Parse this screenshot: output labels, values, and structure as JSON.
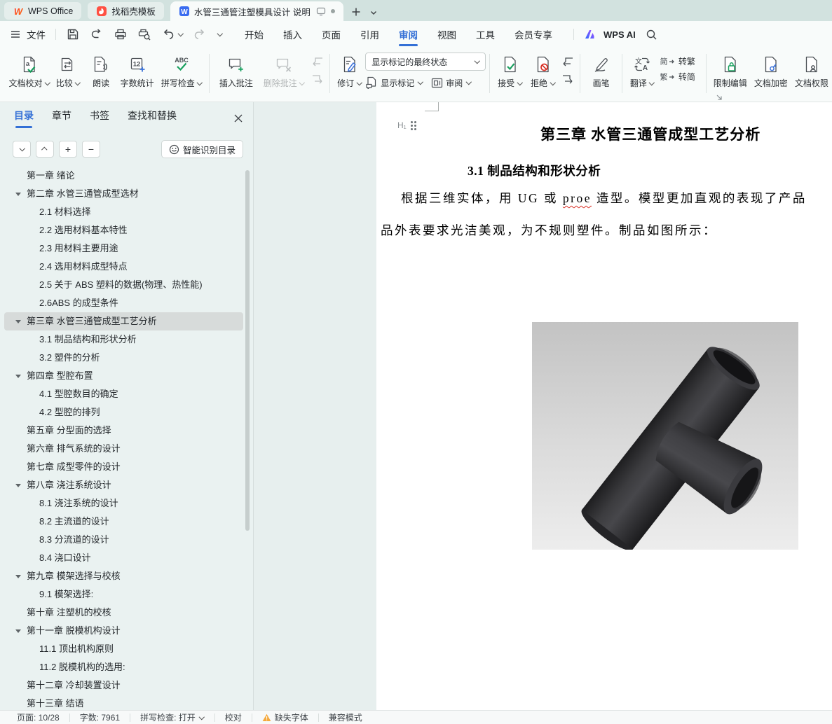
{
  "window": {
    "tabs": [
      {
        "label": "WPS Office"
      },
      {
        "label": "找稻壳模板"
      },
      {
        "label": "水管三通管注塑模具设计 说明"
      }
    ]
  },
  "quick_access": {
    "file_label": "文件"
  },
  "menu": {
    "items": [
      {
        "label": "开始"
      },
      {
        "label": "插入"
      },
      {
        "label": "页面"
      },
      {
        "label": "引用"
      },
      {
        "label": "审阅",
        "active": true
      },
      {
        "label": "视图"
      },
      {
        "label": "工具"
      },
      {
        "label": "会员专享"
      }
    ],
    "wps_ai": "WPS AI"
  },
  "ribbon": {
    "proof": {
      "label": "文档校对",
      "icon_text": "a"
    },
    "compare": {
      "label": "比较"
    },
    "read_aloud": {
      "label": "朗读"
    },
    "word_count": {
      "label": "字数统计",
      "icon_text": "12"
    },
    "spell_check": {
      "label": "拼写检查",
      "icon_text": "ABC"
    },
    "insert_comment": {
      "label": "插入批注"
    },
    "delete_comment": {
      "label": "删除批注"
    },
    "revise": {
      "label": "修订"
    },
    "markup_state": {
      "value": "显示标记的最终状态"
    },
    "show_markup": {
      "label": "显示标记"
    },
    "review_pane": {
      "label": "审阅"
    },
    "accept": {
      "label": "接受"
    },
    "reject": {
      "label": "拒绝"
    },
    "pen": {
      "label": "画笔"
    },
    "translate": {
      "label": "翻译"
    },
    "to_traditional": {
      "label": "转繁",
      "icon_text": "简"
    },
    "to_simplified": {
      "label": "转简",
      "icon_text": "繁"
    },
    "restrict_edit": {
      "label": "限制编辑"
    },
    "encrypt": {
      "label": "文档加密"
    },
    "doc_permission": {
      "label": "文档权限"
    }
  },
  "sidebar": {
    "tabs": [
      {
        "label": "目录",
        "active": true
      },
      {
        "label": "章节"
      },
      {
        "label": "书签"
      },
      {
        "label": "查找和替换"
      }
    ],
    "ai_button": "智能识别目录",
    "toc": [
      {
        "label": "第一章 绪论",
        "level": 1,
        "arrow": false
      },
      {
        "label": "第二章 水管三通管成型选材",
        "level": 1,
        "arrow": true
      },
      {
        "label": "2.1 材料选择",
        "level": 2
      },
      {
        "label": "2.2 选用材料基本特性",
        "level": 2
      },
      {
        "label": "2.3 用材料主要用途",
        "level": 2
      },
      {
        "label": "2.4 选用材料成型特点",
        "level": 2
      },
      {
        "label": "2.5 关于 ABS 塑料的数据(物理、热性能)",
        "level": 2
      },
      {
        "label": "2.6ABS 的成型条件",
        "level": 2
      },
      {
        "label": "第三章 水管三通管成型工艺分析",
        "level": 1,
        "arrow": true,
        "selected": true
      },
      {
        "label": "3.1 制品结构和形状分析",
        "level": 2
      },
      {
        "label": "3.2 塑件的分析",
        "level": 2
      },
      {
        "label": "第四章 型腔布置",
        "level": 1,
        "arrow": true
      },
      {
        "label": "4.1 型腔数目的确定",
        "level": 2
      },
      {
        "label": "4.2 型腔的排列",
        "level": 2
      },
      {
        "label": "第五章 分型面的选择",
        "level": 1
      },
      {
        "label": "第六章 排气系统的设计",
        "level": 1
      },
      {
        "label": "第七章 成型零件的设计",
        "level": 1
      },
      {
        "label": "第八章 浇注系统设计",
        "level": 1,
        "arrow": true
      },
      {
        "label": "8.1 浇注系统的设计",
        "level": 2
      },
      {
        "label": "8.2 主流道的设计",
        "level": 2
      },
      {
        "label": "8.3 分流道的设计",
        "level": 2
      },
      {
        "label": "8.4 浇口设计",
        "level": 2
      },
      {
        "label": "第九章 模架选择与校核",
        "level": 1,
        "arrow": true
      },
      {
        "label": "9.1 模架选择:",
        "level": 2
      },
      {
        "label": "第十章 注塑机的校核",
        "level": 1
      },
      {
        "label": "第十一章 脱模机构设计",
        "level": 1,
        "arrow": true
      },
      {
        "label": "11.1 顶出机构原则",
        "level": 2
      },
      {
        "label": "11.2 脱模机构的选用:",
        "level": 2
      },
      {
        "label": "第十二章 冷却装置设计",
        "level": 1
      },
      {
        "label": "第十三章 结语",
        "level": 1
      }
    ]
  },
  "document": {
    "outline_handle": "H₁",
    "heading": "第三章 水管三通管成型工艺分析",
    "subheading": "3.1 制品结构和形状分析",
    "para_line1_pre": "根据三维实体，用 UG 或 ",
    "para_misspelled": "proe",
    "para_line1_post": " 造型。模型更加直观的表现了产品",
    "para_line2": "品外表要求光洁美观，为不规则塑件。制品如图所示："
  },
  "statusbar": {
    "items": [
      {
        "text": "页面: 10/28"
      },
      {
        "text": "字数: 7961"
      },
      {
        "text": "拼写检查: 打开",
        "caret": true
      },
      {
        "text": "校对"
      },
      {
        "text": "缺失字体",
        "warn": true
      },
      {
        "text": "兼容模式"
      }
    ]
  },
  "colors": {
    "accent": "#3470d6",
    "green": "#18a05e",
    "red": "#d93025",
    "warning": "#f5a93c"
  }
}
